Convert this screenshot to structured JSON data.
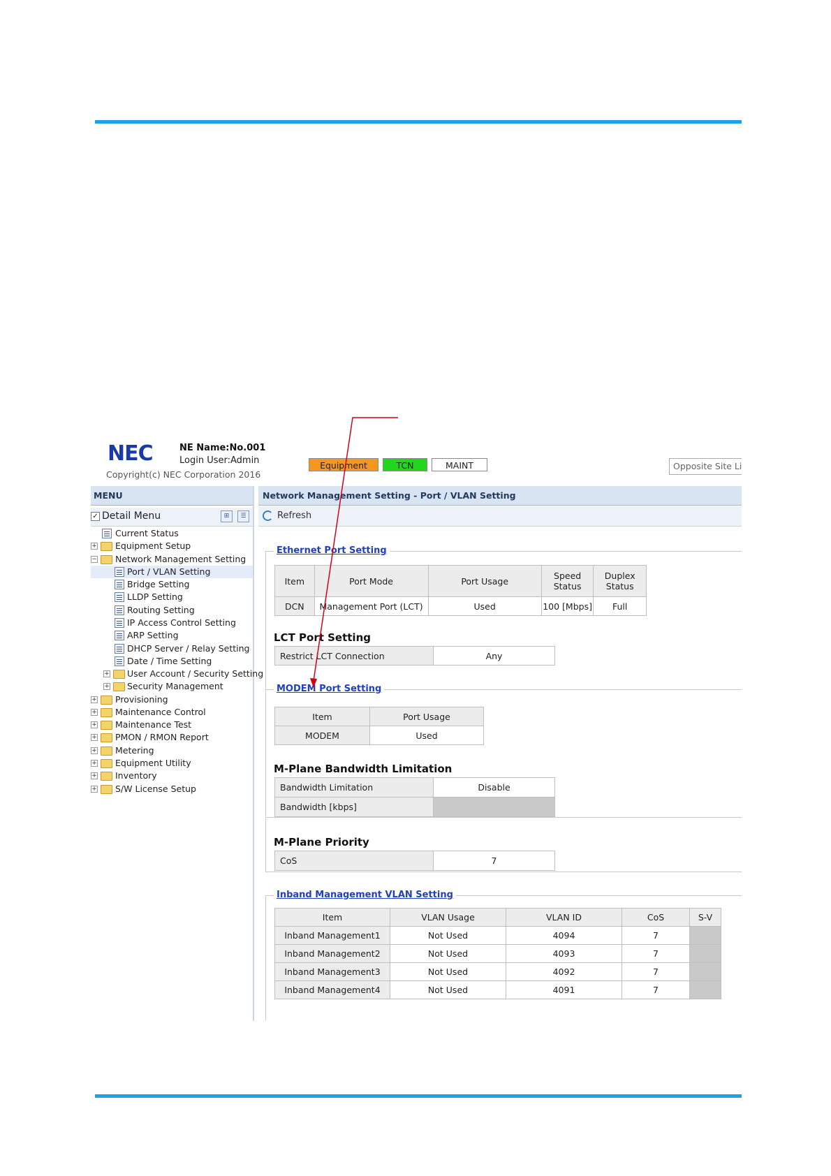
{
  "header": {
    "logo": "NEC",
    "ne_name": "NE Name:No.001",
    "login_user": "Login User:Admin",
    "copyright": "Copyright(c) NEC Corporation 2016",
    "status": [
      {
        "label": "Equipment",
        "color": "#f5961e"
      },
      {
        "label": "TCN",
        "color": "#22d81e"
      },
      {
        "label": "MAINT",
        "color": "#ffffff"
      }
    ],
    "opposite_site": "Opposite Site Lin"
  },
  "menu": {
    "title": "MENU",
    "detail_menu": "Detail Menu",
    "items": [
      {
        "label": "Current Status"
      },
      {
        "label": "Equipment Setup"
      },
      {
        "label": "Network Management Setting"
      },
      {
        "label": "Port / VLAN Setting"
      },
      {
        "label": "Bridge Setting"
      },
      {
        "label": "LLDP Setting"
      },
      {
        "label": "Routing Setting"
      },
      {
        "label": "IP Access Control Setting"
      },
      {
        "label": "ARP Setting"
      },
      {
        "label": "DHCP Server / Relay Setting"
      },
      {
        "label": "Date / Time Setting"
      },
      {
        "label": "User Account / Security Setting"
      },
      {
        "label": "Security Management"
      },
      {
        "label": "Provisioning"
      },
      {
        "label": "Maintenance Control"
      },
      {
        "label": "Maintenance Test"
      },
      {
        "label": "PMON / RMON Report"
      },
      {
        "label": "Metering"
      },
      {
        "label": "Equipment Utility"
      },
      {
        "label": "Inventory"
      },
      {
        "label": "S/W License Setup"
      }
    ]
  },
  "main": {
    "title": "Network Management Setting - Port / VLAN Setting",
    "refresh": "Refresh",
    "ethernet": {
      "legend": "Ethernet Port Setting",
      "headers": [
        "Item",
        "Port Mode",
        "Port Usage",
        "Speed Status",
        "Duplex Status"
      ],
      "row": [
        "DCN",
        "Management Port (LCT)",
        "Used",
        "100 [Mbps]",
        "Full"
      ]
    },
    "lct": {
      "title": "LCT Port Setting",
      "label": "Restrict LCT Connection",
      "value": "Any"
    },
    "modem": {
      "legend": "MODEM Port Setting",
      "headers": [
        "Item",
        "Port Usage"
      ],
      "row": [
        "MODEM",
        "Used"
      ]
    },
    "bandwidth": {
      "title": "M-Plane Bandwidth Limitation",
      "limitation_label": "Bandwidth Limitation",
      "limitation_value": "Disable",
      "kbps_label": "Bandwidth [kbps]"
    },
    "priority": {
      "title": "M-Plane Priority",
      "cos_label": "CoS",
      "cos_value": "7"
    },
    "inband": {
      "legend": "Inband Management VLAN Setting",
      "headers": [
        "Item",
        "VLAN Usage",
        "VLAN ID",
        "CoS",
        "S-V"
      ],
      "rows": [
        [
          "Inband Management1",
          "Not Used",
          "4094",
          "7"
        ],
        [
          "Inband Management2",
          "Not Used",
          "4093",
          "7"
        ],
        [
          "Inband Management3",
          "Not Used",
          "4092",
          "7"
        ],
        [
          "Inband Management4",
          "Not Used",
          "4091",
          "7"
        ]
      ]
    }
  },
  "annotation_color": "#d0021b"
}
